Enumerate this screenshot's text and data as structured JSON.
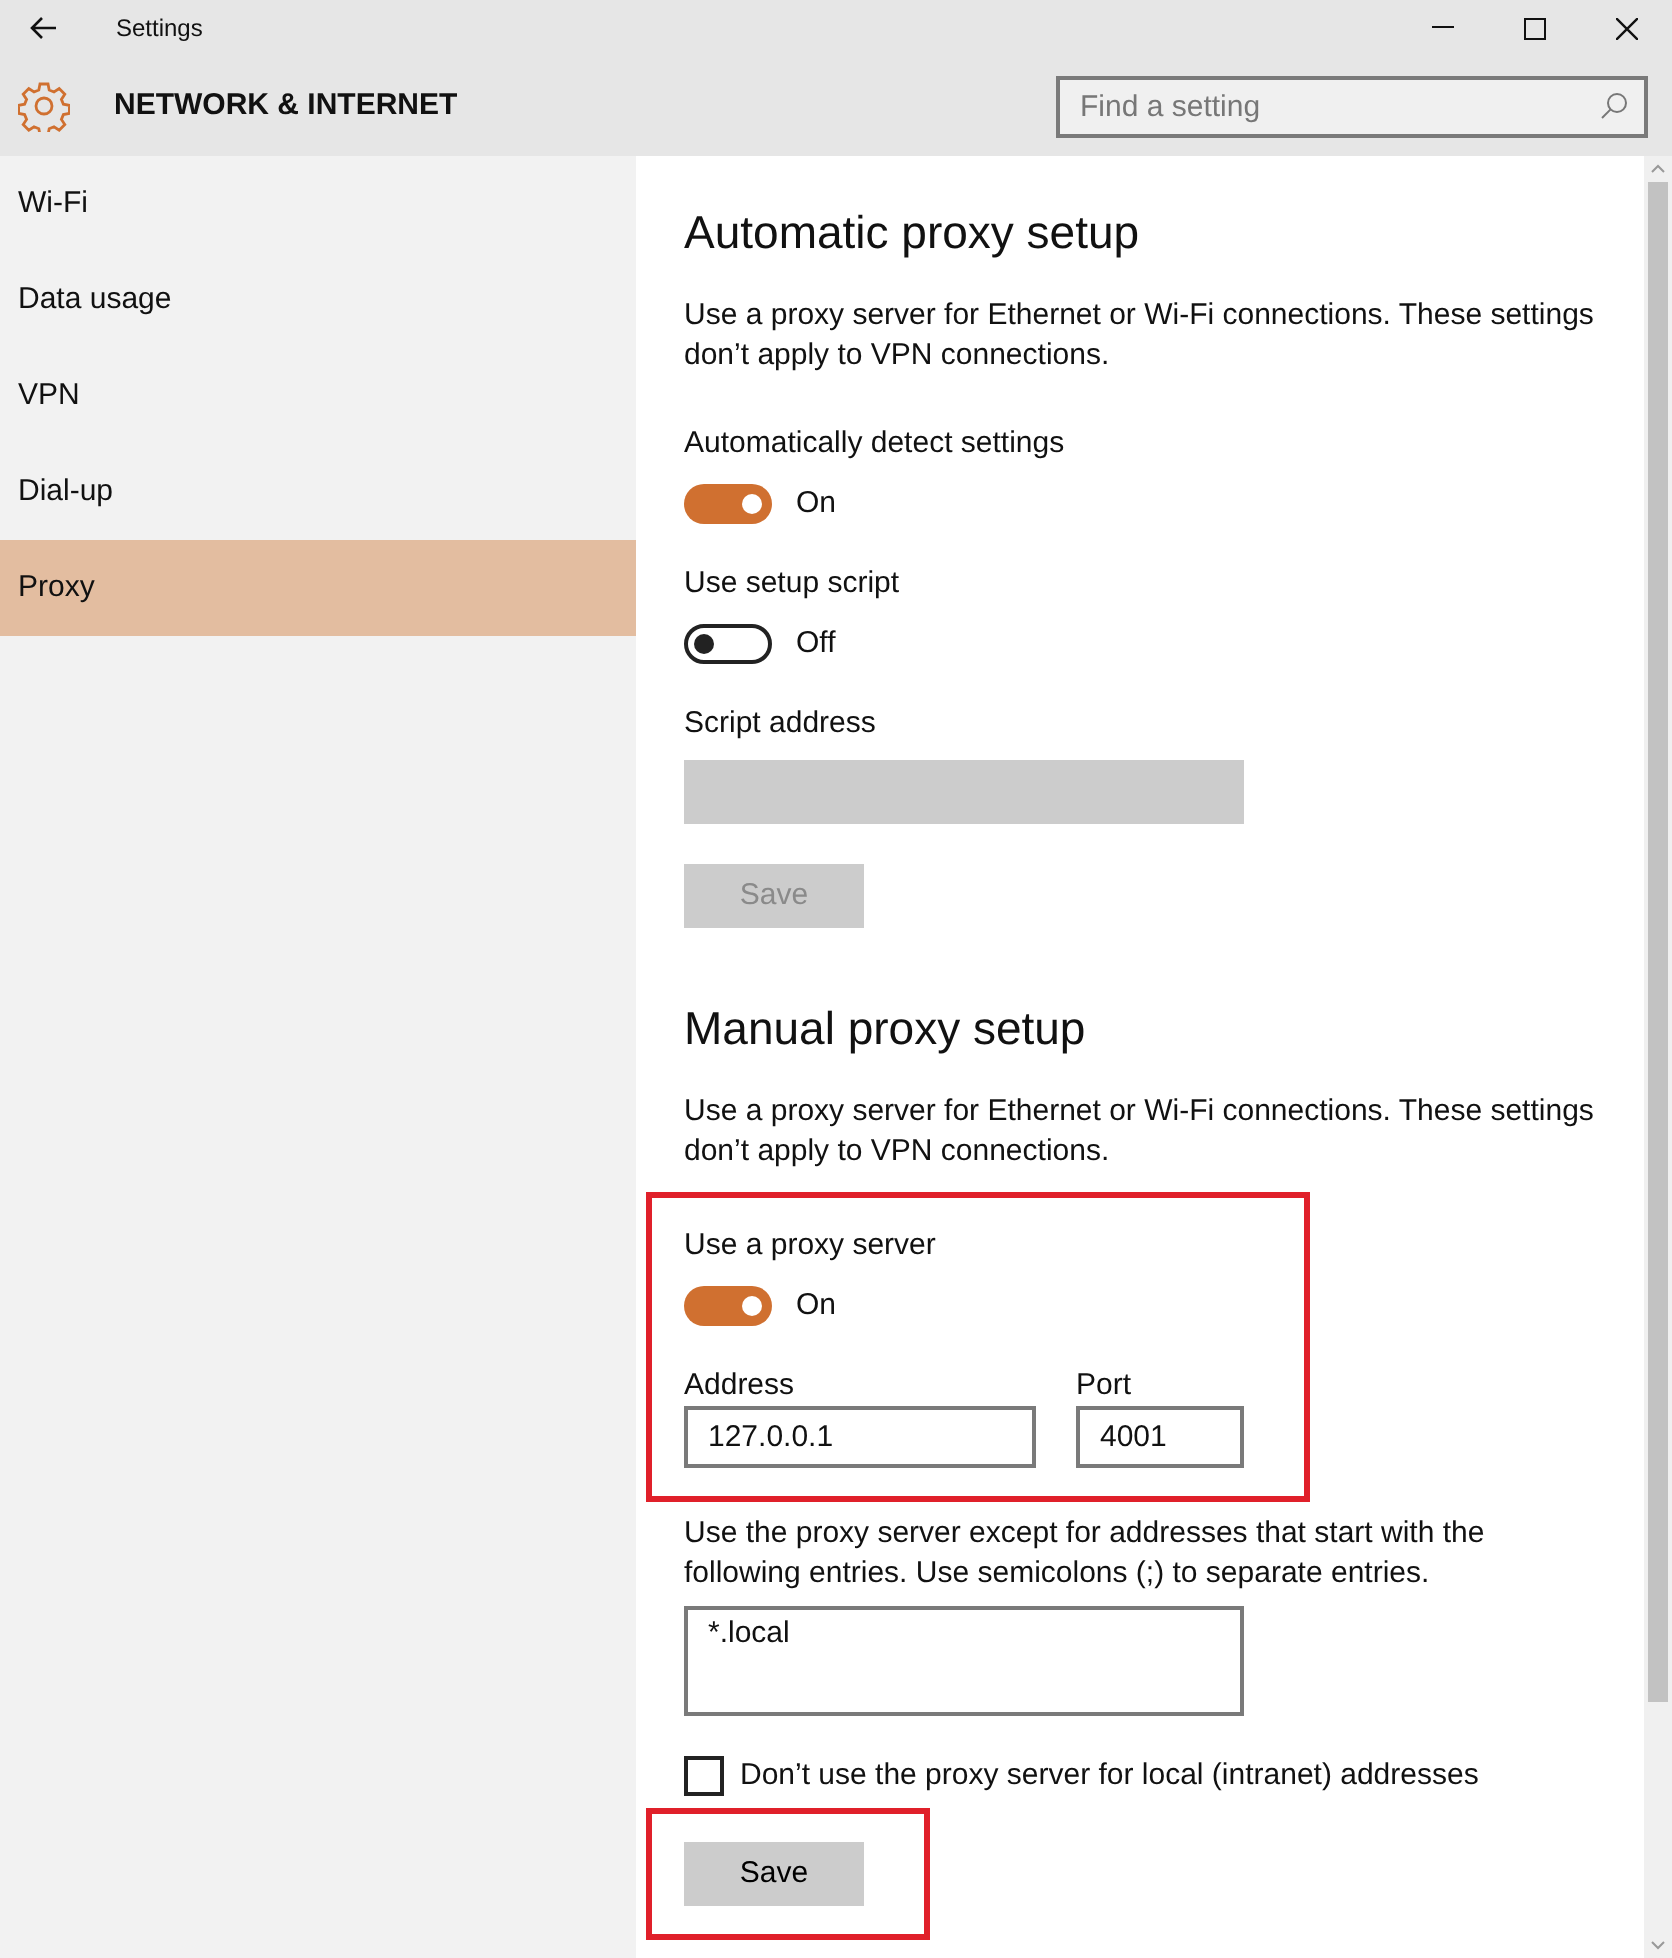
{
  "window": {
    "title": "Settings"
  },
  "header": {
    "title": "NETWORK & INTERNET",
    "search": {
      "placeholder": "Find a setting"
    }
  },
  "sidebar": {
    "items": [
      {
        "label": "Wi-Fi",
        "selected": false
      },
      {
        "label": "Data usage",
        "selected": false
      },
      {
        "label": "VPN",
        "selected": false
      },
      {
        "label": "Dial-up",
        "selected": false
      },
      {
        "label": "Proxy",
        "selected": true
      }
    ]
  },
  "sections": [
    {
      "heading": "Automatic proxy setup",
      "description": "Use a proxy server for Ethernet or Wi-Fi connections. These settings don’t apply to VPN connections.",
      "controls": [
        {
          "kind": "toggle",
          "label": "Automatically detect settings",
          "on": true,
          "state_text": "On"
        },
        {
          "kind": "toggle",
          "label": "Use setup script",
          "on": false,
          "state_text": "Off"
        },
        {
          "kind": "field",
          "label": "Script address",
          "disabled": true
        },
        {
          "kind": "button",
          "label": "Save",
          "disabled": true
        }
      ]
    },
    {
      "heading": "Manual proxy setup",
      "description": "Use a proxy server for Ethernet or Wi-Fi connections. These settings don’t apply to VPN connections.",
      "controls": [
        {
          "kind": "group",
          "highlighted": true,
          "children": [
            {
              "kind": "toggle",
              "label": "Use a proxy server",
              "on": true,
              "state_text": "On"
            },
            {
              "kind": "address_port",
              "address_label": "Address",
              "address": "127.0.0.1",
              "port_label": "Port",
              "port": "4001"
            }
          ]
        },
        {
          "kind": "textarea",
          "label": "Use the proxy server except for addresses that start with the following entries. Use semicolons (;) to separate entries.",
          "value": "*.local"
        },
        {
          "kind": "checkbox",
          "label": "Don’t use the proxy server for local (intranet) addresses",
          "checked": false
        },
        {
          "kind": "group",
          "highlighted": true,
          "children": [
            {
              "kind": "button",
              "label": "Save",
              "disabled": false
            }
          ]
        }
      ]
    }
  ]
}
